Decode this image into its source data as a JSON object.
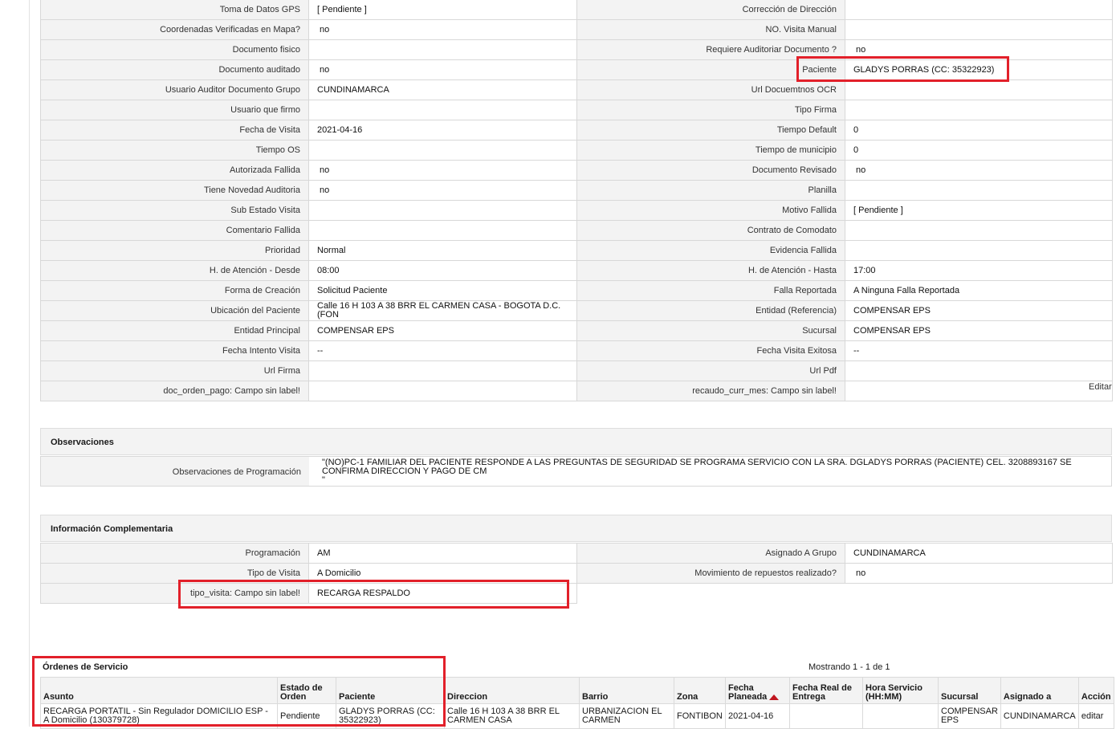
{
  "details": [
    {
      "l1": "Toma de Datos GPS",
      "v1": "[ Pendiente ]",
      "l2": "Corrección de Dirección",
      "v2": ""
    },
    {
      "l1": "Coordenadas Verificadas en Mapa?",
      "v1": "no",
      "l2": "NO. Visita Manual",
      "v2": ""
    },
    {
      "l1": "Documento fisico",
      "v1": "",
      "l2": "Requiere Auditoriar Documento ?",
      "v2": "no"
    },
    {
      "l1": "Documento auditado",
      "v1": "no",
      "l2": "Paciente",
      "v2": "GLADYS PORRAS (CC: 35322923)"
    },
    {
      "l1": "Usuario Auditor Documento Grupo",
      "v1": "CUNDINAMARCA",
      "l2": "Url Docuemtnos OCR",
      "v2": ""
    },
    {
      "l1": "Usuario que firmo",
      "v1": "",
      "l2": "Tipo Firma",
      "v2": ""
    },
    {
      "l1": "Fecha de Visita",
      "v1": "2021-04-16",
      "l2": "Tiempo Default",
      "v2": "0"
    },
    {
      "l1": "Tiempo OS",
      "v1": "",
      "l2": "Tiempo de municipio",
      "v2": "0"
    },
    {
      "l1": "Autorizada Fallida",
      "v1": "no",
      "l2": "Documento Revisado",
      "v2": "no"
    },
    {
      "l1": "Tiene Novedad Auditoria",
      "v1": "no",
      "l2": "Planilla",
      "v2": ""
    },
    {
      "l1": "Sub Estado Visita",
      "v1": "",
      "l2": "Motivo Fallida",
      "v2": "[ Pendiente ]"
    },
    {
      "l1": "Comentario Fallida",
      "v1": "",
      "l2": "Contrato de Comodato",
      "v2": ""
    },
    {
      "l1": "Prioridad",
      "v1": "Normal",
      "l2": "Evidencia Fallida",
      "v2": ""
    },
    {
      "l1": "H. de Atención - Desde",
      "v1": "08:00",
      "l2": "H. de Atención - Hasta",
      "v2": "17:00"
    },
    {
      "l1": "Forma de Creación",
      "v1": "Solicitud Paciente",
      "l2": "Falla Reportada",
      "v2": "A Ninguna Falla Reportada"
    },
    {
      "l1": "Ubicación del Paciente",
      "v1": "Calle 16 H 103 A 38 BRR EL CARMEN CASA - BOGOTA D.C. (FON",
      "l2": "Entidad (Referencia)",
      "v2": "COMPENSAR EPS"
    },
    {
      "l1": "Entidad Principal",
      "v1": "COMPENSAR EPS",
      "l2": "Sucursal",
      "v2": "COMPENSAR EPS"
    },
    {
      "l1": "Fecha Intento Visita",
      "v1": "--",
      "l2": "Fecha Visita Exitosa",
      "v2": "--"
    },
    {
      "l1": "Url Firma",
      "v1": "",
      "l2": "Url Pdf",
      "v2": ""
    },
    {
      "l1": "doc_orden_pago: Campo sin label!",
      "v1": "",
      "l2": "recaudo_curr_mes: Campo sin label!",
      "v2": ""
    }
  ],
  "edit_link": "Editar",
  "observaciones": {
    "title": "Observaciones",
    "label": "Observaciones de Programación",
    "value": "\"(NO)PC-1 FAMILIAR DEL PACIENTE RESPONDE A LAS PREGUNTAS DE SEGURIDAD SE PROGRAMA SERVICIO CON LA SRA. DGLADYS PORRAS (PACIENTE) CEL. 3208893167 SE CONFIRMA DIRECCION Y PAGO DE CM\n\""
  },
  "complementaria": {
    "title": "Información Complementaria",
    "rows": [
      {
        "l1": "Programación",
        "v1": "AM",
        "l2": "Asignado A Grupo",
        "v2": "CUNDINAMARCA"
      },
      {
        "l1": "Tipo de Visita",
        "v1": "A Domicilio",
        "l2": "Movimiento de repuestos realizado?",
        "v2": "no"
      },
      {
        "l1": "tipo_visita: Campo sin label!",
        "v1": "RECARGA RESPALDO"
      }
    ]
  },
  "orders": {
    "title": "Órdenes de Servicio",
    "count": "Mostrando 1 - 1 de 1",
    "headers": [
      "Asunto",
      "Estado de Orden",
      "Paciente",
      "Direccion",
      "Barrio",
      "Zona",
      "Fecha Planeada",
      "Fecha Real de Entrega",
      "Hora Servicio (HH:MM)",
      "Sucursal",
      "Asignado a",
      "Acción"
    ],
    "row": {
      "asunto": "RECARGA PORTATIL - Sin Regulador DOMICILIO ESP - A Domicilio (130379728)",
      "estado": "Pendiente",
      "paciente": "GLADYS PORRAS (CC: 35322923)",
      "direccion": "Calle 16 H 103 A 38 BRR EL CARMEN CASA",
      "barrio": "URBANIZACION EL CARMEN",
      "zona": "FONTIBON",
      "fecha_planeada": "2021-04-16",
      "fecha_real": "",
      "hora": "",
      "sucursal": "COMPENSAR EPS",
      "asignado": "CUNDINAMARCA",
      "accion": "editar"
    }
  },
  "colors": {
    "highlight": "#e2202a",
    "sort_icon": "#c0161f"
  }
}
